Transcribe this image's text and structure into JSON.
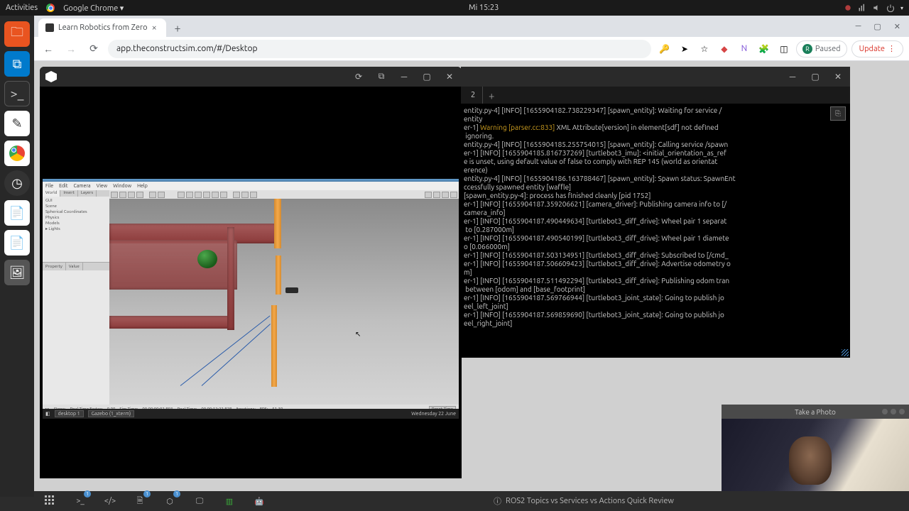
{
  "gnome": {
    "activities": "Activities",
    "app": "Google Chrome",
    "clock": "Mi 15:23"
  },
  "chrome": {
    "tab_title": "Learn Robotics from Zero",
    "url": "app.theconstructsim.com/#/Desktop",
    "paused": "Paused",
    "update": "Update"
  },
  "gazebo": {
    "menu": [
      "File",
      "Edit",
      "Camera",
      "View",
      "Window",
      "Help"
    ],
    "panel_tabs": [
      "World",
      "Insert",
      "Layers"
    ],
    "tree": [
      "GUI",
      "Scene",
      "Spherical Coordinates",
      "Physics",
      "Models",
      "▸ Lights"
    ],
    "prop_head": [
      "Property",
      "Value"
    ],
    "status": {
      "pause": "▸▸",
      "steps": "Steps:",
      "rtf_label": "Real Time Factor:",
      "rtf": "0.00",
      "sim_label": "Sim Time:",
      "sim": "00 00:00:02.893",
      "real_label": "Real Time:",
      "real": "00 00:12:22.828",
      "iter_label": "Iterations:",
      "fps_label": "FPS:",
      "fps": "51.30",
      "reset": "Reset Time"
    },
    "taskbar": {
      "item1": "desktop 1",
      "item2": "Gazebo (1_xterm)",
      "time": "Wednesday 22 June"
    }
  },
  "terminal": {
    "tab": "2",
    "lines": [
      "entity.py-4] [INFO] [1655904182.738229347] [spawn_entity]: Waiting for service /",
      "entity",
      "er-1] Warning [parser.cc:833] XML Attribute[version] in element[sdf] not defined",
      " ignoring.",
      "entity.py-4] [INFO] [1655904185.255754015] [spawn_entity]: Calling service /spawn",
      "",
      "er-1] [INFO] [1655904185.816737269] [turtlebot3_imu]: <initial_orientation_as_ref",
      "e is unset, using default value of false to comply with REP 145 (world as orientat",
      "erence)",
      "entity.py-4] [INFO] [1655904186.163788467] [spawn_entity]: Spawn status: SpawnEnt",
      "ccessfully spawned entity [waffle]",
      "[spawn_entity.py-4]: process has finished cleanly [pid 1752]",
      "er-1] [INFO] [1655904187.359206621] [camera_driver]: Publishing camera info to [/",
      "camera_info]",
      "er-1] [INFO] [1655904187.490449634] [turtlebot3_diff_drive]: Wheel pair 1 separat",
      " to [0.287000m]",
      "er-1] [INFO] [1655904187.490540199] [turtlebot3_diff_drive]: Wheel pair 1 diamete",
      "o [0.066000m]",
      "er-1] [INFO] [1655904187.503134951] [turtlebot3_diff_drive]: Subscribed to [/cmd_",
      "",
      "er-1] [INFO] [1655904187.506609423] [turtlebot3_diff_drive]: Advertise odometry o",
      "m]",
      "er-1] [INFO] [1655904187.511492294] [turtlebot3_diff_drive]: Publishing odom tran",
      " between [odom] and [base_footprint]",
      "er-1] [INFO] [1655904187.569766944] [turtlebot3_joint_state]: Going to publish jo",
      "eel_left_joint]",
      "er-1] [INFO] [1655904187.569859690] [turtlebot3_joint_state]: Going to publish jo",
      "eel_right_joint]"
    ]
  },
  "webcam": {
    "title": "Take a Photo"
  },
  "bottom": {
    "tip": "ROS2 Topics vs Services vs Actions Quick Review",
    "badges": {
      "term": "1",
      "ide": "1",
      "notebook": "1"
    }
  }
}
